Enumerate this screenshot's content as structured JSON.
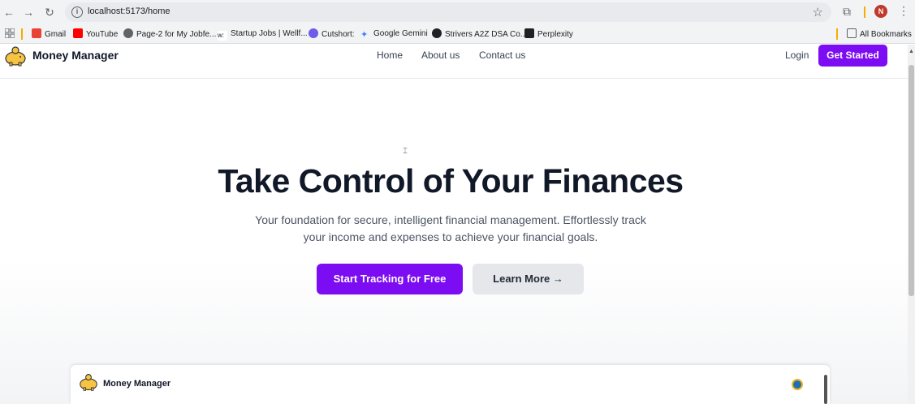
{
  "browser": {
    "url": "localhost:5173/home",
    "avatar_letter": "N",
    "bookmarks": [
      {
        "label": "Gmail",
        "icon": "gmail-icon",
        "color": "#ea4335"
      },
      {
        "label": "YouTube",
        "icon": "youtube-icon",
        "color": "#ff0000"
      },
      {
        "label": "Page-2 for My Jobfe...",
        "icon": "globe-icon",
        "color": "#5f6368"
      },
      {
        "label": "Startup Jobs | Wellf...",
        "icon": "wellfound-icon",
        "color": "#202124"
      },
      {
        "label": "Cutshort:",
        "icon": "cutshort-icon",
        "color": "#6c5ce7"
      },
      {
        "label": "Google Gemini",
        "icon": "gemini-icon",
        "color": "#4285f4"
      },
      {
        "label": "Strivers A2Z DSA Co...",
        "icon": "tuf-icon",
        "color": "#202124"
      },
      {
        "label": "Perplexity",
        "icon": "perplexity-icon",
        "color": "#202124"
      }
    ],
    "all_bookmarks": "All Bookmarks"
  },
  "header": {
    "brand": "Money Manager",
    "nav": [
      "Home",
      "About us",
      "Contact us"
    ],
    "login": "Login",
    "get_started": "Get Started"
  },
  "hero": {
    "title": "Take Control of Your Finances",
    "subtitle": "Your foundation for secure, intelligent financial management. Effortlessly track your income and expenses to achieve your financial goals.",
    "primary_cta": "Start Tracking for Free",
    "secondary_cta": "Learn More →"
  },
  "preview": {
    "brand": "Money Manager"
  },
  "colors": {
    "accent": "#7c0cf2",
    "text_dark": "#111827",
    "text_muted": "#4b5563"
  }
}
